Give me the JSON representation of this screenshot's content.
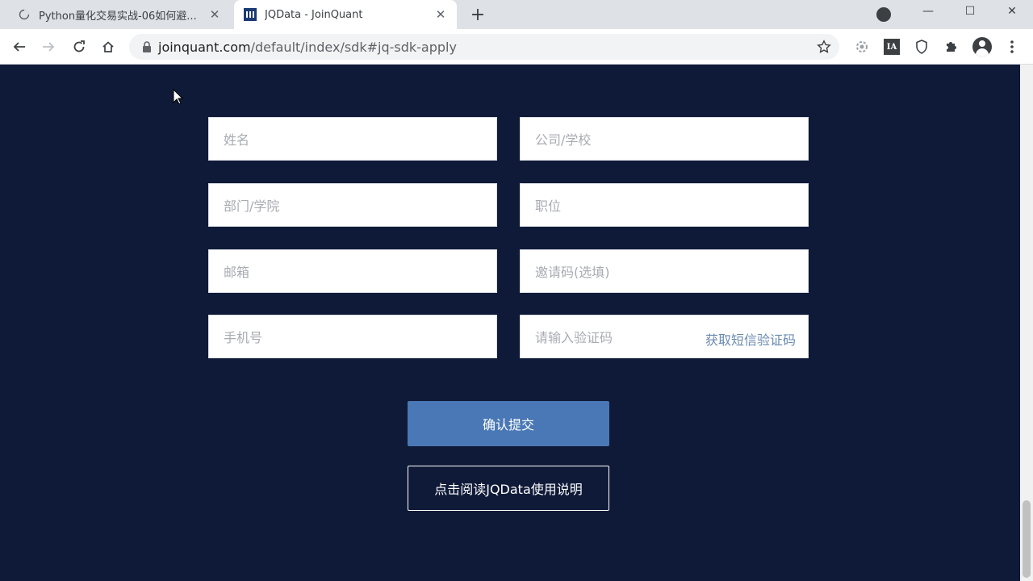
{
  "tabs": [
    {
      "title": "Python量化交易实战-06如何避...",
      "favicon": "loading-spinner-icon"
    },
    {
      "title": "JQData - JoinQuant",
      "favicon": "joinquant-logo-icon"
    }
  ],
  "address_bar": {
    "host": "joinquant.com",
    "path": "/default/index/sdk#jq-sdk-apply"
  },
  "form": {
    "name_placeholder": "姓名",
    "company_placeholder": "公司/学校",
    "department_placeholder": "部门/学院",
    "position_placeholder": "职位",
    "email_placeholder": "邮箱",
    "invite_placeholder": "邀请码(选填)",
    "phone_placeholder": "手机号",
    "code_placeholder": "请输入验证码",
    "sms_link": "获取短信验证码",
    "submit_label": "确认提交",
    "read_label": "点击阅读JQData使用说明"
  },
  "colors": {
    "page_bg": "#0f1a38",
    "submit_bg": "#4a78b6",
    "link": "#6a8ab0"
  }
}
